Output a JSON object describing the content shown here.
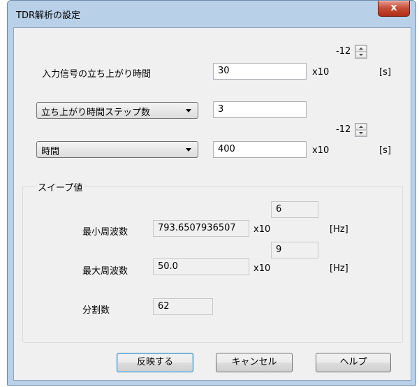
{
  "window": {
    "title": "TDR解析の設定",
    "close_label": "x"
  },
  "rise_time": {
    "label": "入力信号の立ち上がり時間",
    "value": "30",
    "x10_label": "x10",
    "exponent": "-12",
    "unit": "[s]"
  },
  "steps": {
    "combo_value": "立ち上がり時間ステップ数",
    "value": "3"
  },
  "time": {
    "combo_value": "時間",
    "value": "400",
    "x10_label": "x10",
    "exponent": "-12",
    "unit": "[s]"
  },
  "sweep": {
    "group_title": "スイープ値",
    "min_freq": {
      "label": "最小周波数",
      "value": "793.6507936507",
      "x10_label": "x10",
      "exponent": "6",
      "unit": "[Hz]"
    },
    "max_freq": {
      "label": "最大周波数",
      "value": "50.0",
      "x10_label": "x10",
      "exponent": "9",
      "unit": "[Hz]"
    },
    "divisions": {
      "label": "分割数",
      "value": "62"
    }
  },
  "buttons": {
    "apply": "反映する",
    "cancel": "キャンセル",
    "help": "ヘルプ"
  }
}
